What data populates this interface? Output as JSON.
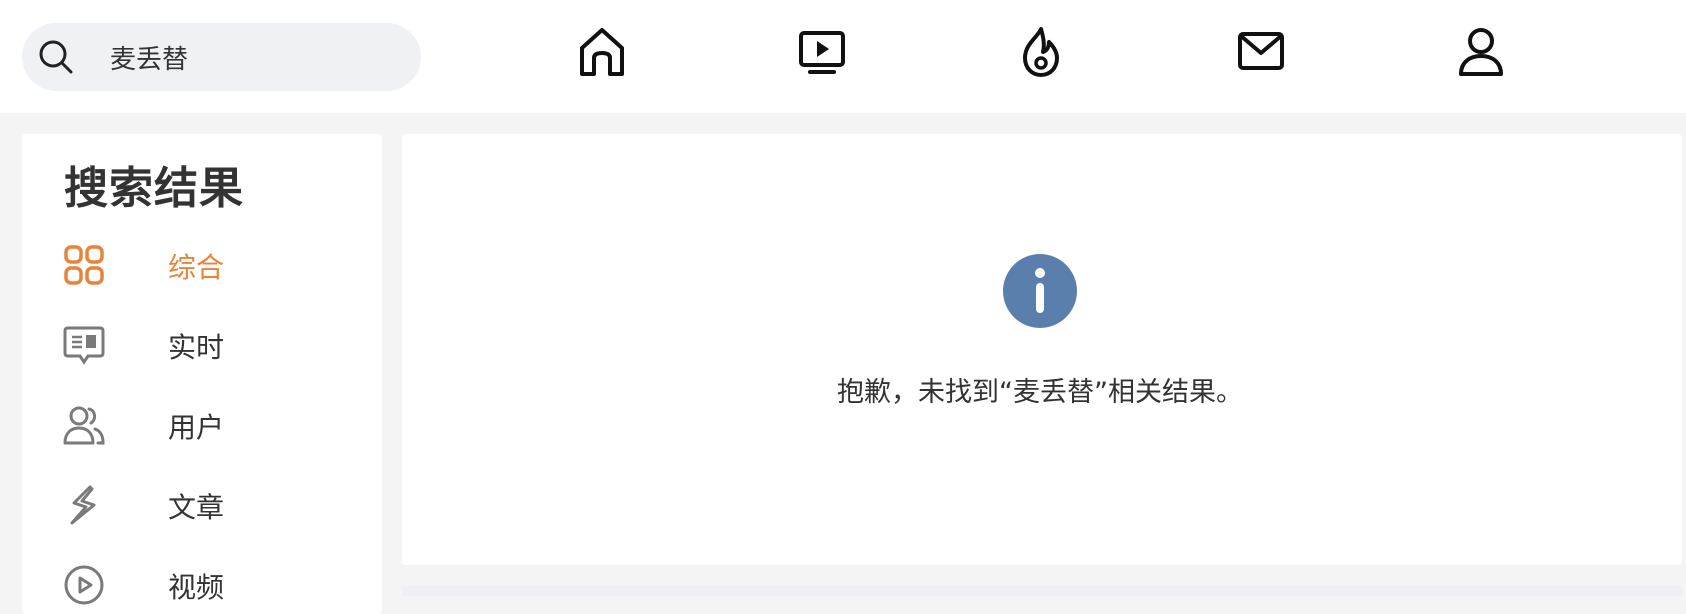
{
  "search": {
    "value": "麦丢替",
    "placeholder": ""
  },
  "nav": [
    {
      "icon": "home-icon"
    },
    {
      "icon": "video-icon"
    },
    {
      "icon": "fire-icon"
    },
    {
      "icon": "mail-icon"
    },
    {
      "icon": "user-icon"
    }
  ],
  "sidebar": {
    "title": "搜索结果",
    "items": [
      {
        "label": "综合",
        "icon": "grid-icon",
        "active": true
      },
      {
        "label": "实时",
        "icon": "realtime-icon"
      },
      {
        "label": "用户",
        "icon": "users-icon"
      },
      {
        "label": "文章",
        "icon": "article-icon"
      },
      {
        "label": "视频",
        "icon": "play-circle-icon"
      }
    ]
  },
  "main": {
    "icon": "info-icon",
    "message": "抱歉，未找到“麦丢替”相关结果。"
  },
  "colors": {
    "accent": "#e8843a",
    "info": "#5b7fac",
    "icon_gray": "#7a7a7a"
  }
}
